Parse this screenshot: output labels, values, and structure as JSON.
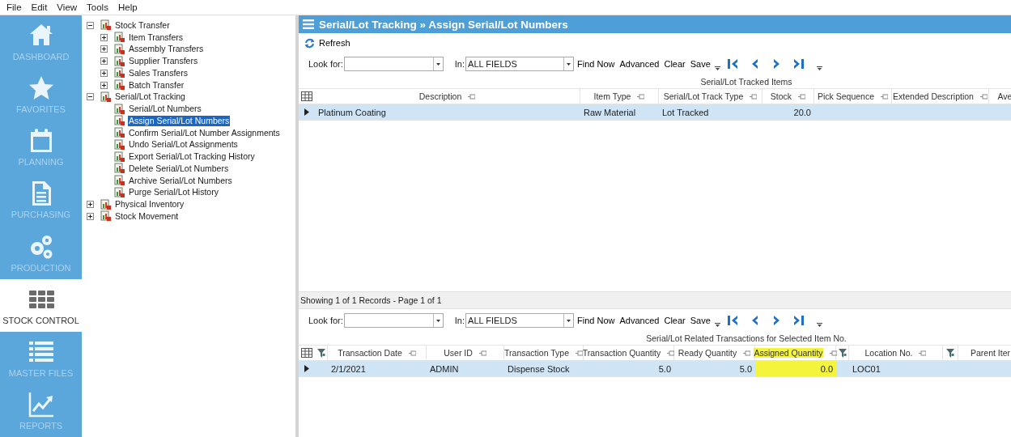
{
  "menu": [
    "File",
    "Edit",
    "View",
    "Tools",
    "Help"
  ],
  "nav": [
    {
      "label": "DASHBOARD",
      "selected": false
    },
    {
      "label": "FAVORITES",
      "selected": false
    },
    {
      "label": "PLANNING",
      "selected": false
    },
    {
      "label": "PURCHASING",
      "selected": false
    },
    {
      "label": "PRODUCTION",
      "selected": false
    },
    {
      "label": "STOCK CONTROL",
      "selected": true
    },
    {
      "label": "MASTER FILES",
      "selected": false
    },
    {
      "label": "REPORTS",
      "selected": false
    }
  ],
  "tree": [
    {
      "label": "Stock Transfer",
      "expanded": true,
      "selected": false,
      "children": [
        {
          "label": "Item Transfers",
          "expanded": false,
          "selected": false
        },
        {
          "label": "Assembly Transfers",
          "expanded": false,
          "selected": false
        },
        {
          "label": "Supplier Transfers",
          "expanded": false,
          "selected": false
        },
        {
          "label": "Sales Transfers",
          "expanded": false,
          "selected": false
        },
        {
          "label": "Batch Transfer",
          "expanded": false,
          "selected": false
        }
      ]
    },
    {
      "label": "Serial/Lot Tracking",
      "expanded": true,
      "selected": false,
      "children": [
        {
          "label": "Serial/Lot Numbers",
          "selected": false
        },
        {
          "label": "Assign Serial/Lot Numbers",
          "selected": true
        },
        {
          "label": "Confirm Serial/Lot Number Assignments",
          "selected": false
        },
        {
          "label": "Undo Serial/Lot Assignments",
          "selected": false
        },
        {
          "label": "Export Serial/Lot Tracking History",
          "selected": false
        },
        {
          "label": "Delete Serial/Lot Numbers",
          "selected": false
        },
        {
          "label": "Archive Serial/Lot Numbers",
          "selected": false
        },
        {
          "label": "Purge Serial/Lot History",
          "selected": false
        }
      ]
    },
    {
      "label": "Physical Inventory",
      "expanded": false,
      "selected": false
    },
    {
      "label": "Stock Movement",
      "expanded": false,
      "selected": false
    }
  ],
  "title": "Serial/Lot Tracking » Assign Serial/Lot Numbers",
  "refresh": "Refresh",
  "grids": [
    {
      "toolbar": {
        "look_for": "Look for:",
        "in": "In:",
        "in_value": "ALL FIELDS",
        "buttons": [
          "Find Now",
          "Advanced",
          "Clear",
          "Save"
        ]
      },
      "caption": "Serial/Lot Tracked Items",
      "columns": [
        {
          "kind": "text",
          "label": "Description",
          "highlighted": false
        },
        {
          "kind": "text",
          "label": "Item Type",
          "highlighted": false
        },
        {
          "kind": "text",
          "label": "Serial/Lot Track Type",
          "highlighted": false
        },
        {
          "kind": "text",
          "label": "Stock",
          "highlighted": false
        },
        {
          "kind": "text",
          "label": "Pick Sequence",
          "highlighted": false
        },
        {
          "kind": "text",
          "label": "Extended Description",
          "highlighted": false
        },
        {
          "kind": "text",
          "label": "Ave",
          "highlighted": false
        }
      ],
      "rows": [
        {
          "selected": true,
          "cells": [
            "Platinum Coating",
            "Raw Material",
            "Lot Tracked",
            "20.0",
            null,
            null,
            null
          ]
        }
      ]
    },
    {
      "toolbar": {
        "look_for": "Look for:",
        "in": "In:",
        "in_value": "ALL FIELDS",
        "buttons": [
          "Find Now",
          "Advanced",
          "Clear",
          "Save"
        ]
      },
      "caption": "Serial/Lot Related Transactions for Selected Item No.",
      "columns": [
        {
          "kind": "filter"
        },
        {
          "kind": "text",
          "label": "Transaction Date",
          "highlighted": false
        },
        {
          "kind": "text",
          "label": "User ID",
          "highlighted": false
        },
        {
          "kind": "text",
          "label": "Transaction Type",
          "highlighted": false
        },
        {
          "kind": "text",
          "label": "Transaction Quantity",
          "highlighted": false
        },
        {
          "kind": "text",
          "label": "Ready Quantity",
          "highlighted": false
        },
        {
          "kind": "text",
          "label": "Assigned Quantity",
          "highlighted": true
        },
        {
          "kind": "filter"
        },
        {
          "kind": "text",
          "label": "Location No.",
          "highlighted": false
        },
        {
          "kind": "filter"
        },
        {
          "kind": "text",
          "label": "Parent Iter",
          "highlighted": false
        }
      ],
      "rows": [
        {
          "selected": true,
          "cells": [
            null,
            "2/1/2021",
            "ADMIN",
            "Dispense Stock",
            "5.0",
            "5.0",
            "0.0",
            null,
            "LOC01",
            null,
            null
          ]
        }
      ]
    }
  ],
  "status": "Showing 1 of 1 Records - Page 1 of 1"
}
